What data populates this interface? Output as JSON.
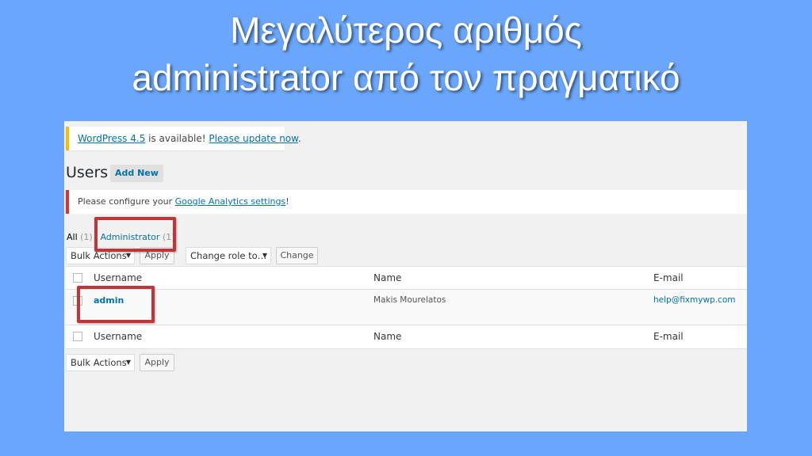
{
  "slide": {
    "title_line1": "Μεγαλύτερος αριθμός",
    "title_line2": "administrator από τον πραγματικό"
  },
  "update_notice": {
    "version_link": "WordPress 4.5",
    "middle_text": " is available! ",
    "update_link": "Please update now",
    "end_text": "."
  },
  "page": {
    "heading": "Users",
    "add_new_label": "Add New"
  },
  "ga_notice": {
    "prefix": "Please configure your ",
    "link": "Google Analytics settings",
    "suffix": "!"
  },
  "filters": {
    "all_label": "All",
    "all_count": "(1)",
    "separator": "|",
    "admin_label": "Administrator",
    "admin_count": "(1)"
  },
  "toolbar_top": {
    "bulk_actions": "Bulk Actions",
    "apply": "Apply",
    "change_role": "Change role to…",
    "change": "Change"
  },
  "table": {
    "columns": [
      "Username",
      "Name",
      "E-mail"
    ],
    "rows": [
      {
        "username": "admin",
        "name": "Makis Mourelatos",
        "email": "help@fixmywp.com"
      }
    ]
  },
  "toolbar_bottom": {
    "bulk_actions": "Bulk Actions",
    "apply": "Apply"
  },
  "colors": {
    "background": "#6aa6fb",
    "highlight": "#c0353a",
    "link": "#0073aa"
  }
}
